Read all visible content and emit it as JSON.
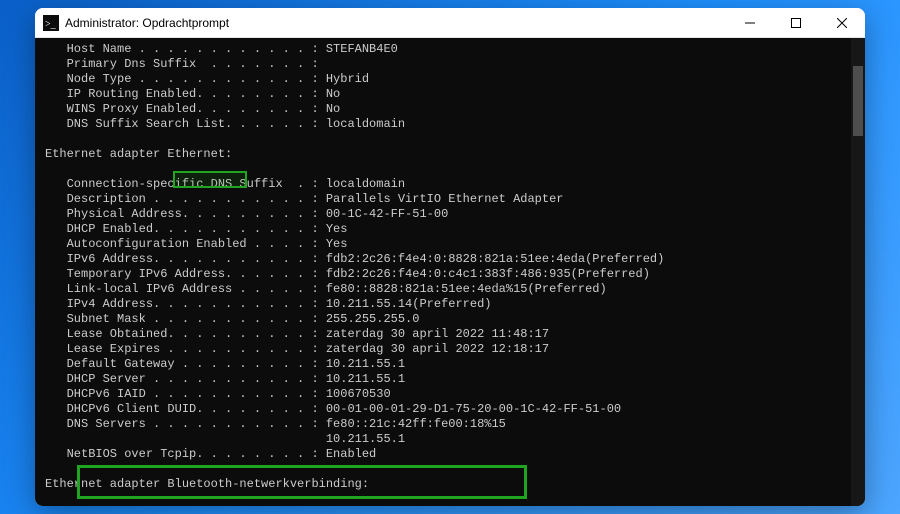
{
  "window": {
    "title": "Administrator: Opdrachtprompt"
  },
  "terminal": {
    "lines": [
      "   Host Name . . . . . . . . . . . . : STEFANB4E0",
      "   Primary Dns Suffix  . . . . . . . :",
      "   Node Type . . . . . . . . . . . . : Hybrid",
      "   IP Routing Enabled. . . . . . . . : No",
      "   WINS Proxy Enabled. . . . . . . . : No",
      "   DNS Suffix Search List. . . . . . : localdomain",
      "",
      "Ethernet adapter Ethernet:",
      "",
      "   Connection-specific DNS Suffix  . : localdomain",
      "   Description . . . . . . . . . . . : Parallels VirtIO Ethernet Adapter",
      "   Physical Address. . . . . . . . . : 00-1C-42-FF-51-00",
      "   DHCP Enabled. . . . . . . . . . . : Yes",
      "   Autoconfiguration Enabled . . . . : Yes",
      "   IPv6 Address. . . . . . . . . . . : fdb2:2c26:f4e4:0:8828:821a:51ee:4eda(Preferred)",
      "   Temporary IPv6 Address. . . . . . : fdb2:2c26:f4e4:0:c4c1:383f:486:935(Preferred)",
      "   Link-local IPv6 Address . . . . . : fe80::8828:821a:51ee:4eda%15(Preferred)",
      "   IPv4 Address. . . . . . . . . . . : 10.211.55.14(Preferred)",
      "   Subnet Mask . . . . . . . . . . . : 255.255.255.0",
      "   Lease Obtained. . . . . . . . . . : zaterdag 30 april 2022 11:48:17",
      "   Lease Expires . . . . . . . . . . : zaterdag 30 april 2022 12:18:17",
      "   Default Gateway . . . . . . . . . : 10.211.55.1",
      "   DHCP Server . . . . . . . . . . . : 10.211.55.1",
      "   DHCPv6 IAID . . . . . . . . . . . : 100670530",
      "   DHCPv6 Client DUID. . . . . . . . : 00-01-00-01-29-D1-75-20-00-1C-42-FF-51-00",
      "   DNS Servers . . . . . . . . . . . : fe80::21c:42ff:fe00:18%15",
      "                                       10.211.55.1",
      "   NetBIOS over Tcpip. . . . . . . . : Enabled",
      "",
      "Ethernet adapter Bluetooth-netwerkverbinding:"
    ]
  },
  "highlights": {
    "ethernet_label": "Ethernet:",
    "dns_servers_label": "DNS Servers"
  }
}
